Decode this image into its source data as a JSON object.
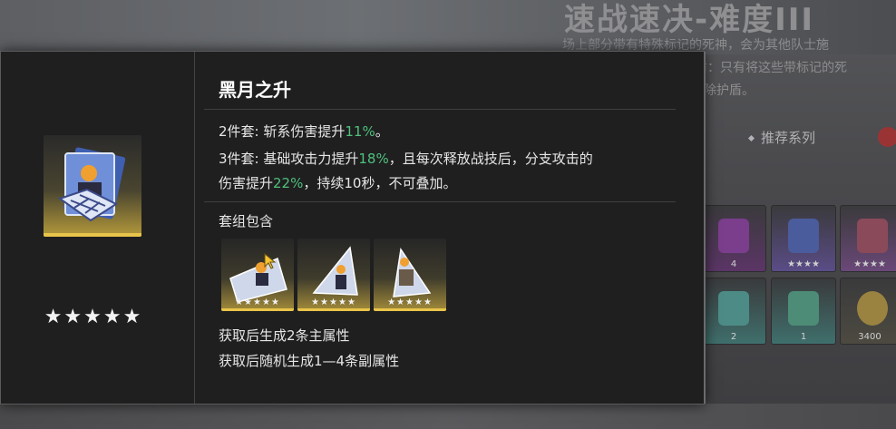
{
  "background": {
    "title": "速战速决-难度III",
    "description_lines": [
      "场上部分带有特殊标记的死神，会为其他队士施",
      "盾：只有将这些带标记的死",
      "除护盾。"
    ],
    "recommend_label": "推荐系列",
    "cards": [
      {
        "count": "4",
        "color": "#7a3e8c"
      },
      {
        "count": "★★★★",
        "color": "#5a4c86"
      },
      {
        "count": "★★★★",
        "color": "#6a4878"
      },
      {
        "count": "2",
        "color": "#3f6f6c"
      },
      {
        "count": "1",
        "color": "#3f6f6c"
      },
      {
        "count": "3400",
        "color": "#4c4a40"
      }
    ]
  },
  "popup": {
    "title": "黑月之升",
    "stars": "★★★★★",
    "set2_prefix": "2件套:  斩系伤害提升",
    "set2_value": "11%",
    "set2_suffix": "。",
    "set3_prefix": "3件套:   基础攻击力提升",
    "set3_value": "18%",
    "set3_suffix": "，且每次释放战技后，分支攻击的",
    "set3_line2_prefix": "伤害提升",
    "set3_line2_value": "22%",
    "set3_line2_suffix": "，持续10秒，不可叠加。",
    "contains_label": "套组包含",
    "pieces": [
      {
        "stars": "★★★★★"
      },
      {
        "stars": "★★★★★"
      },
      {
        "stars": "★★★★★"
      }
    ],
    "info1": "获取后生成2条主属性",
    "info2": "获取后随机生成1—4条副属性"
  },
  "colors": {
    "highlight": "#4fc07c",
    "gold": "#e8c44a"
  }
}
